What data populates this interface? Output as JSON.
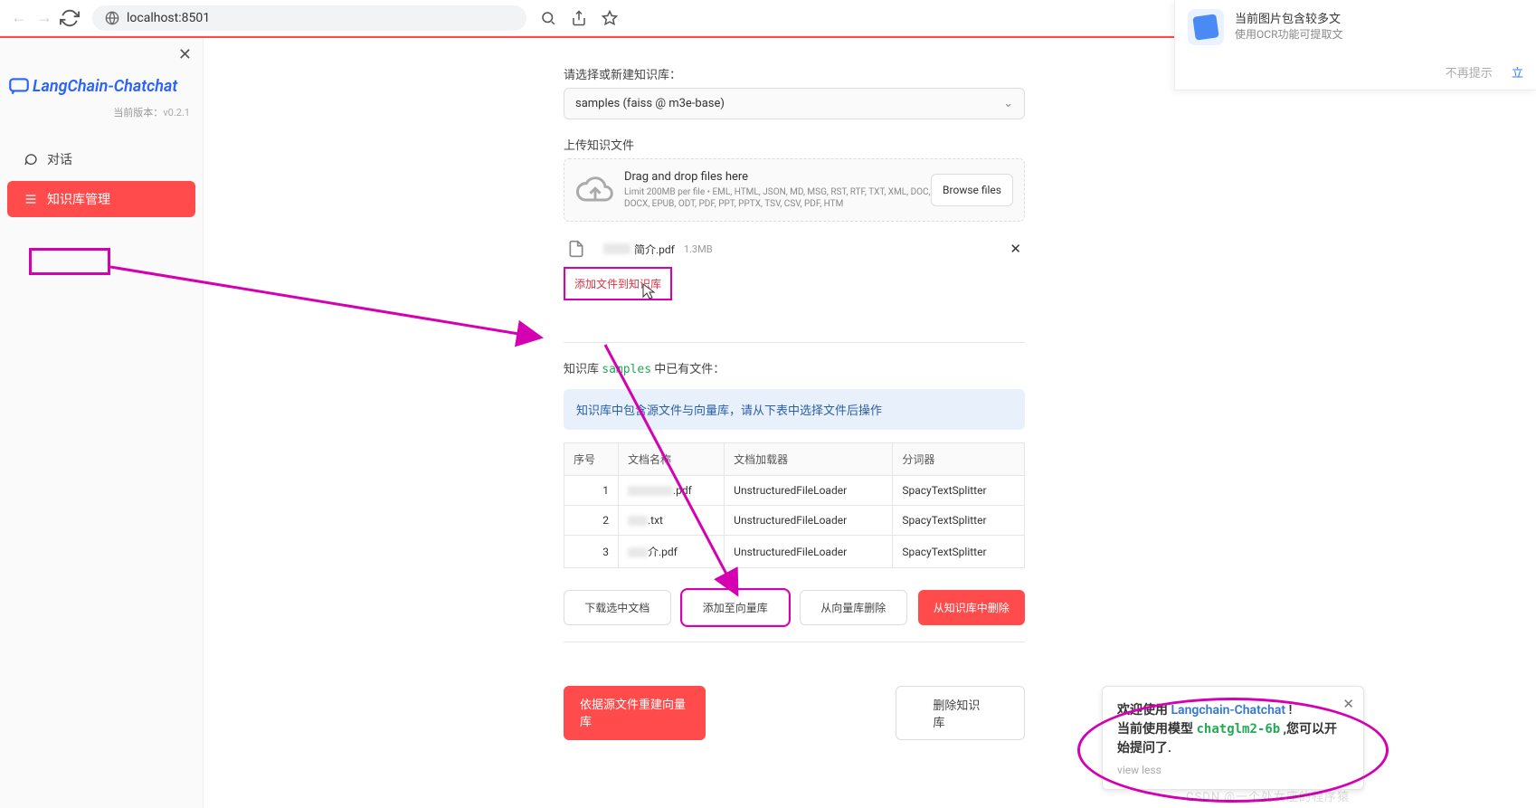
{
  "browser": {
    "url": "localhost:8501"
  },
  "topNotif": {
    "line1": "当前图片包含较多文",
    "line2": "使用OCR功能可提取文",
    "dismiss": "不再提示",
    "ok": "立"
  },
  "sidebar": {
    "logoText": "LangChain-Chatchat",
    "versionLabel": "当前版本：",
    "versionNum": "v0.2.1",
    "items": [
      {
        "label": "对话"
      },
      {
        "label": "知识库管理"
      }
    ]
  },
  "main": {
    "selectLabel": "请选择或新建知识库：",
    "selectValue": "samples (faiss @ m3e-base)",
    "uploadLabel": "上传知识文件",
    "dropTitle": "Drag and drop files here",
    "dropDesc": "Limit 200MB per file • EML, HTML, JSON, MD, MSG, RST, RTF, TXT, XML, DOC, DOCX, EPUB, ODT, PDF, PPT, PPTX, TSV, CSV, PDF, HTM",
    "browse": "Browse files",
    "uploadedFile": {
      "suffix": "简介.pdf",
      "size": "1.3MB"
    },
    "addBtn": "添加文件到知识库",
    "kbSummaryPrefix": "知识库",
    "kbName": "samples",
    "kbSummarySuffix": "中已有文件：",
    "infoBox": "知识库中包含源文件与向量库，请从下表中选择文件后操作",
    "table": {
      "cols": [
        "序号",
        "文档名称",
        "文档加载器",
        "分词器"
      ],
      "rows": [
        {
          "num": "1",
          "name": ".pdf",
          "loader": "UnstructuredFileLoader",
          "splitter": "SpacyTextSplitter"
        },
        {
          "num": "2",
          "name": ".txt",
          "loader": "UnstructuredFileLoader",
          "splitter": "SpacyTextSplitter"
        },
        {
          "num": "3",
          "name": "介.pdf",
          "loader": "UnstructuredFileLoader",
          "splitter": "SpacyTextSplitter"
        }
      ]
    },
    "buttons": {
      "download": "下载选中文档",
      "addVector": "添加至向量库",
      "removeVector": "从向量库删除",
      "removeKB": "从知识库中删除",
      "rebuild": "依据源文件重建向量库",
      "deleteKB": "删除知识库"
    }
  },
  "toast": {
    "welcomePrefix": "欢迎使用 ",
    "welcomeLink": "Langchain-Chatchat",
    "welcomeSuffix": " !",
    "modelPrefix": "当前使用模型 ",
    "modelName": "chatglm2-6b",
    "modelSuffix": " ,您可以开始提问了.",
    "viewLess": "view less"
  },
  "watermark": "CSDN @一个处女座的程序猿"
}
